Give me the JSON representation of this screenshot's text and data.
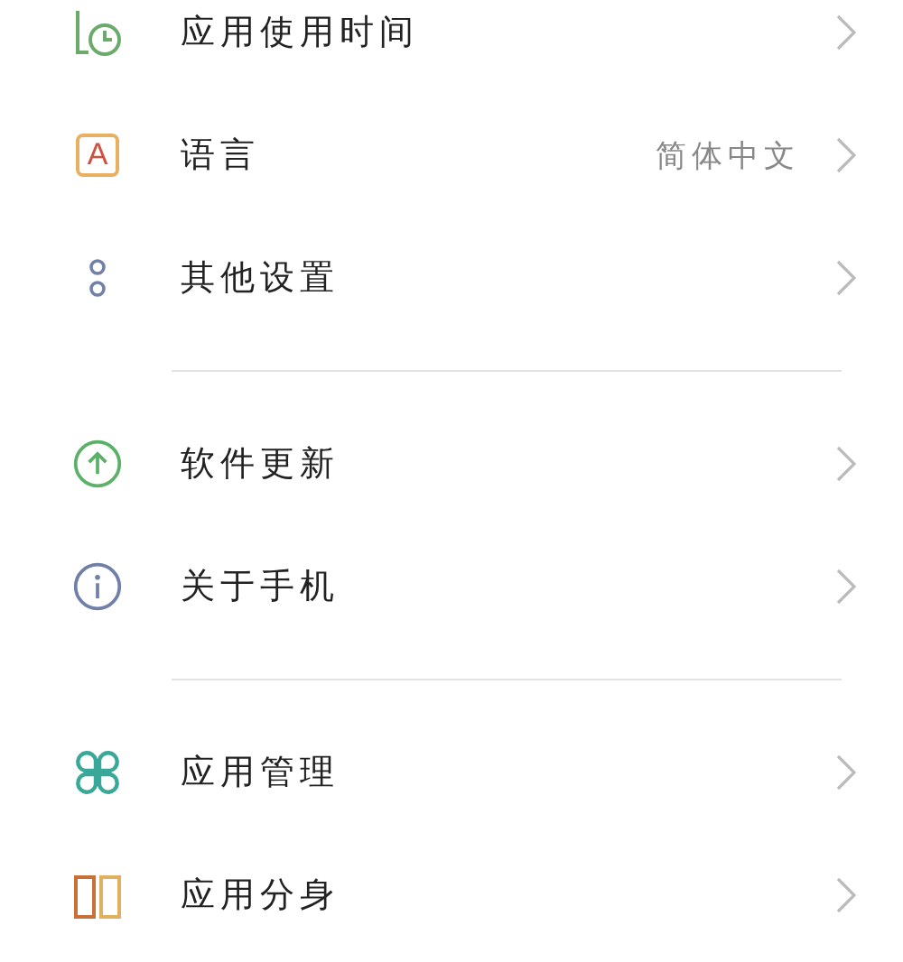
{
  "groups": [
    {
      "items": [
        {
          "label": "应用使用时间"
        },
        {
          "label": "语言",
          "icon_glyph": "A",
          "value": "简体中文"
        },
        {
          "label": "其他设置"
        }
      ]
    },
    {
      "items": [
        {
          "label": "软件更新"
        },
        {
          "label": "关于手机"
        }
      ]
    },
    {
      "items": [
        {
          "label": "应用管理"
        },
        {
          "label": "应用分身"
        }
      ]
    }
  ]
}
